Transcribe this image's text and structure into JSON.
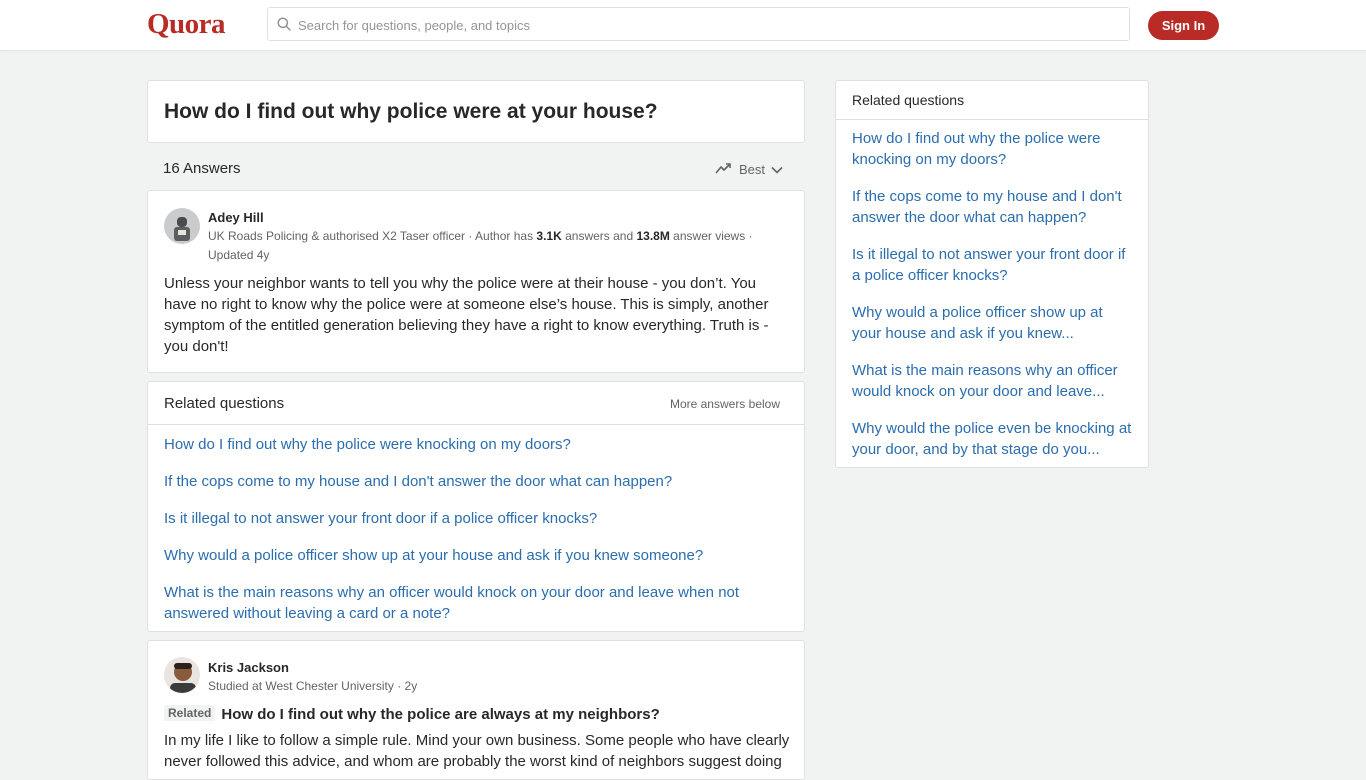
{
  "header": {
    "logo": "Quora",
    "search_placeholder": "Search for questions, people, and topics",
    "signin_label": "Sign In"
  },
  "question": {
    "title": "How do I find out why police were at your house?"
  },
  "answers_bar": {
    "count_label": "16 Answers",
    "sort_label": "Best"
  },
  "answer1": {
    "author": "Adey Hill",
    "cred_prefix": "UK Roads Policing & authorised X2 Taser officer · Author has ",
    "answers_count": "3.1K",
    "cred_mid": " answers and ",
    "views_count": "13.8M",
    "cred_suffix": " answer views ·",
    "updated": "Updated 4y",
    "text": "Unless your neighbor wants to tell you why the police were at their house - you don’t. You have no right to know why the police were at someone else’s house. This is simply, another symptom of the entitled generation believing they have a right to know everything. Truth is - you don't!"
  },
  "related_mid": {
    "title": "Related questions",
    "more_label": "More answers below",
    "items": [
      "How do I find out why the police were knocking on my doors?",
      "If the cops come to my house and I don't answer the door what can happen?",
      "Is it illegal to not answer your front door if a police officer knocks?",
      "Why would a police officer show up at your house and ask if you knew someone?",
      "What is the main reasons why an officer would knock on your door and leave when not answered without leaving a card or a note?"
    ]
  },
  "answer2": {
    "author": "Kris Jackson",
    "cred": "Studied at West Chester University · 2y",
    "related_tag": "Related",
    "related_question": "How do I find out why the police are always at my neighbors?",
    "text": "In my life I like to follow a simple rule. Mind your own business. Some people who have clearly never followed this advice, and whom are probably the worst kind of neighbors suggest doing"
  },
  "sidebar": {
    "title": "Related questions",
    "items": [
      "How do I find out why the police were knocking on my doors?",
      "If the cops come to my house and I don't answer the door what can happen?",
      "Is it illegal to not answer your front door if a police officer knocks?",
      "Why would a police officer show up at your house and ask if you knew...",
      "What is the main reasons why an officer would knock on your door and leave...",
      "Why would the police even be knocking at your door, and by that stage do you..."
    ]
  },
  "colors": {
    "brand": "#b92b27",
    "link": "#2b6dad",
    "background": "#f1f2f2"
  }
}
